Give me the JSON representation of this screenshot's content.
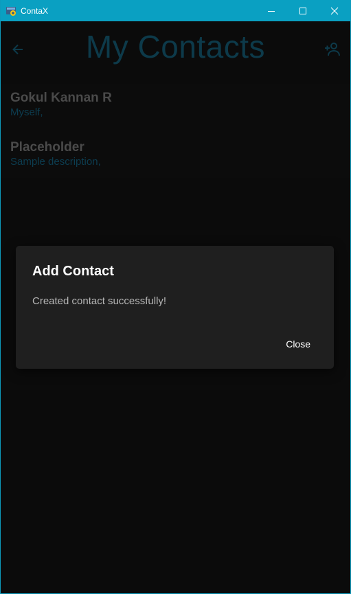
{
  "window": {
    "title": "ContaX",
    "icon": "python-app-icon",
    "controls": [
      "minimize-icon",
      "maximize-icon",
      "close-icon"
    ],
    "accent_color": "#0aa0c2"
  },
  "appbar": {
    "title": "My Contacts",
    "back_icon": "arrow-left-icon",
    "add_icon": "person-add-icon"
  },
  "contacts": [
    {
      "name": "Gokul Kannan R",
      "description": "Myself,"
    },
    {
      "name": "Placeholder",
      "description": "Sample description,"
    }
  ],
  "dialog": {
    "title": "Add Contact",
    "message": "Created contact successfully!",
    "close_label": "Close"
  }
}
